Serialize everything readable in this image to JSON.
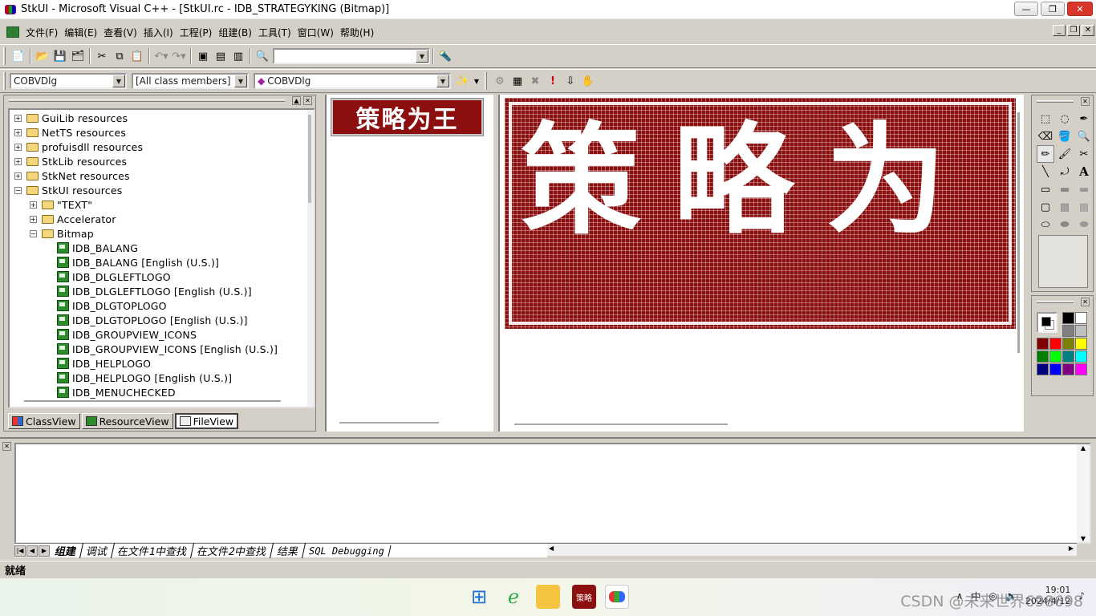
{
  "window": {
    "title": "StkUI - Microsoft Visual C++ - [StkUI.rc - IDB_STRATEGYKING (Bitmap)]",
    "minimize": "—",
    "restore": "❐",
    "close": "✕"
  },
  "menu": [
    "文件(F)",
    "编辑(E)",
    "查看(V)",
    "插入(I)",
    "工程(P)",
    "组建(B)",
    "工具(T)",
    "窗口(W)",
    "帮助(H)"
  ],
  "toolbar2": {
    "class_combo": "COBVDlg",
    "filter_combo": "[All class members]",
    "member_combo": "COBVDlg"
  },
  "workspace": {
    "tree": [
      {
        "label": "GuiLib resources",
        "level": 0,
        "type": "folder",
        "expander": "+"
      },
      {
        "label": "NetTS resources",
        "level": 0,
        "type": "folder",
        "expander": "+"
      },
      {
        "label": "profuisdll resources",
        "level": 0,
        "type": "folder",
        "expander": "+"
      },
      {
        "label": "StkLib resources",
        "level": 0,
        "type": "folder",
        "expander": "+"
      },
      {
        "label": "StkNet resources",
        "level": 0,
        "type": "folder",
        "expander": "+"
      },
      {
        "label": "StkUI resources",
        "level": 0,
        "type": "folder",
        "expander": "−"
      },
      {
        "label": "\"TEXT\"",
        "level": 1,
        "type": "folder",
        "expander": "+"
      },
      {
        "label": "Accelerator",
        "level": 1,
        "type": "folder",
        "expander": "+"
      },
      {
        "label": "Bitmap",
        "level": 1,
        "type": "folder",
        "expander": "−"
      },
      {
        "label": "IDB_BALANG",
        "level": 2,
        "type": "bitmap",
        "expander": ""
      },
      {
        "label": "IDB_BALANG [English (U.S.)]",
        "level": 2,
        "type": "bitmap",
        "expander": ""
      },
      {
        "label": "IDB_DLGLEFTLOGO",
        "level": 2,
        "type": "bitmap",
        "expander": ""
      },
      {
        "label": "IDB_DLGLEFTLOGO [English (U.S.)]",
        "level": 2,
        "type": "bitmap",
        "expander": ""
      },
      {
        "label": "IDB_DLGTOPLOGO",
        "level": 2,
        "type": "bitmap",
        "expander": ""
      },
      {
        "label": "IDB_DLGTOPLOGO [English (U.S.)]",
        "level": 2,
        "type": "bitmap",
        "expander": ""
      },
      {
        "label": "IDB_GROUPVIEW_ICONS",
        "level": 2,
        "type": "bitmap",
        "expander": ""
      },
      {
        "label": "IDB_GROUPVIEW_ICONS [English (U.S.)]",
        "level": 2,
        "type": "bitmap",
        "expander": ""
      },
      {
        "label": "IDB_HELPLOGO",
        "level": 2,
        "type": "bitmap",
        "expander": ""
      },
      {
        "label": "IDB_HELPLOGO [English (U.S.)]",
        "level": 2,
        "type": "bitmap",
        "expander": ""
      },
      {
        "label": "IDB_MENUCHECKED",
        "level": 2,
        "type": "bitmap",
        "expander": ""
      }
    ],
    "tabs": [
      "ClassView",
      "ResourceView",
      "FileView"
    ]
  },
  "bitmap": {
    "thumb_text": "策略为王",
    "canvas_text": "策略为",
    "color_fill": "#8b0f0f"
  },
  "output": {
    "tabs": [
      "组建",
      "调试",
      "在文件1中查找",
      "在文件2中查找",
      "结果",
      "SQL Debugging"
    ]
  },
  "status": "就绪",
  "taskbar": {
    "clock_time": "19:01",
    "clock_date": "2024/4/12",
    "ime": "中",
    "watermark": "CSDN @未来世界698698"
  }
}
